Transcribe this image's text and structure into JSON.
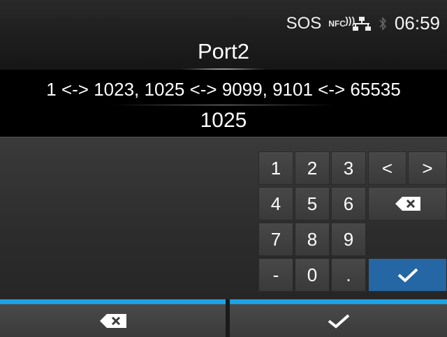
{
  "status": {
    "sos": "SOS",
    "nfc": "NFC",
    "time": "06:59"
  },
  "header": {
    "title": "Port2"
  },
  "range_text": "1 <-> 1023, 1025 <-> 9099, 9101 <-> 65535",
  "input": {
    "value": "1025"
  },
  "keypad": {
    "k1": "1",
    "k2": "2",
    "k3": "3",
    "k4": "4",
    "k5": "5",
    "k6": "6",
    "k7": "7",
    "k8": "8",
    "k9": "9",
    "minus": "-",
    "k0": "0",
    "dot": ".",
    "left": "<",
    "right": ">"
  },
  "colors": {
    "accent": "#1aa3e6",
    "ok": "#2566a4"
  },
  "icons": {
    "backspace": "backspace-icon",
    "confirm": "checkmark-icon"
  }
}
